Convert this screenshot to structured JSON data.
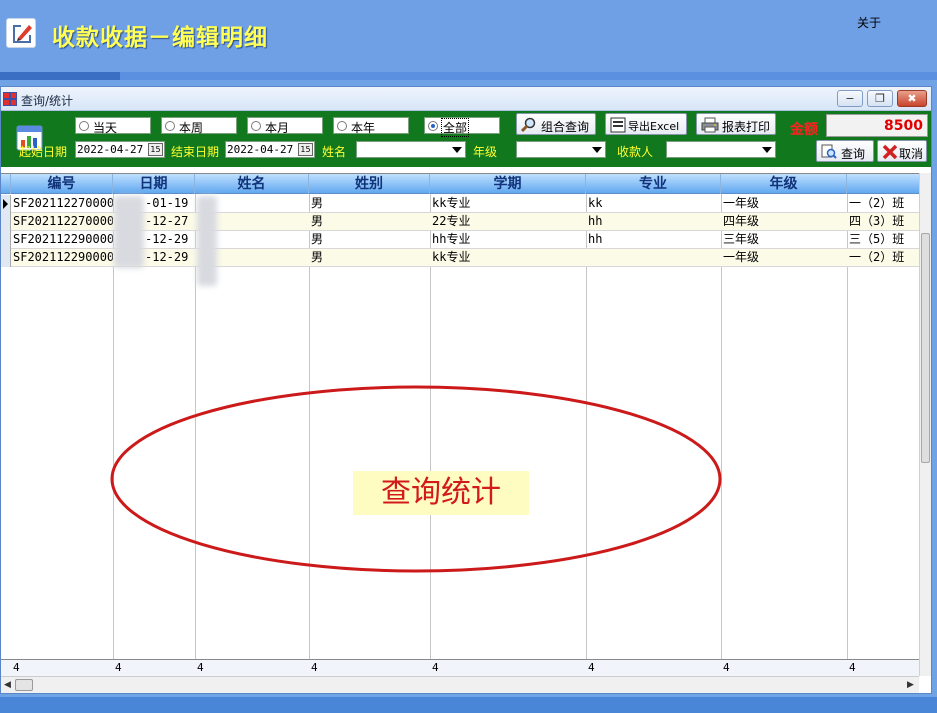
{
  "app": {
    "title": "收款收据－编辑明细",
    "about": "关于"
  },
  "dialog": {
    "title": "查询/统计",
    "minimize": "−",
    "restore": "❐",
    "close": "✖"
  },
  "filters": {
    "ranges": [
      {
        "label": "当天",
        "selected": false
      },
      {
        "label": "本周",
        "selected": false
      },
      {
        "label": "本月",
        "selected": false
      },
      {
        "label": "本年",
        "selected": false
      },
      {
        "label": "全部",
        "selected": true
      }
    ],
    "start_label": "起始日期",
    "start_date": "2022-04-27",
    "end_label": "结束日期",
    "end_date": "2022-04-27",
    "calendar_glyph": "15",
    "name_label": "姓名",
    "grade_label": "年级",
    "payee_label": "收款人"
  },
  "toolbar": {
    "combo_query": "组合查询",
    "export_excel": "导出Excel",
    "print_report": "报表打印",
    "query": "查询",
    "cancel": "取消"
  },
  "amount": {
    "label": "金额",
    "value": "8500"
  },
  "grid": {
    "columns": [
      "编号",
      "日期",
      "姓名",
      "姓别",
      "学期",
      "专业",
      "年级",
      ""
    ],
    "rows": [
      {
        "id": "SF202112270000",
        "date": "-01-19",
        "name": "",
        "gender": "男",
        "term": "kk专业",
        "major": "kk",
        "grade": "一年级",
        "class": "一（2）班"
      },
      {
        "id": "SF202112270000",
        "date": "-12-27",
        "name": "",
        "gender": "男",
        "term": "22专业",
        "major": "hh",
        "grade": "四年级",
        "class": "四（3）班"
      },
      {
        "id": "SF202112290000",
        "date": "-12-29",
        "name": "",
        "gender": "男",
        "term": "hh专业",
        "major": "hh",
        "grade": "三年级",
        "class": "三（5）班"
      },
      {
        "id": "SF202112290000",
        "date": "-12-29",
        "name": "",
        "gender": "男",
        "term": "kk专业",
        "major": "",
        "grade": "一年级",
        "class": "一（2）班"
      }
    ],
    "footer": [
      "4",
      "4",
      "4",
      "4",
      "4",
      "4",
      "4",
      "4"
    ]
  },
  "annotation": {
    "text": "查询统计"
  },
  "colors": {
    "header_bg": "#6f9fe5",
    "title_yellow": "#ffff55",
    "filter_green": "#11781d",
    "amount_red": "#e00000",
    "annotation_red": "#d21a1a"
  }
}
